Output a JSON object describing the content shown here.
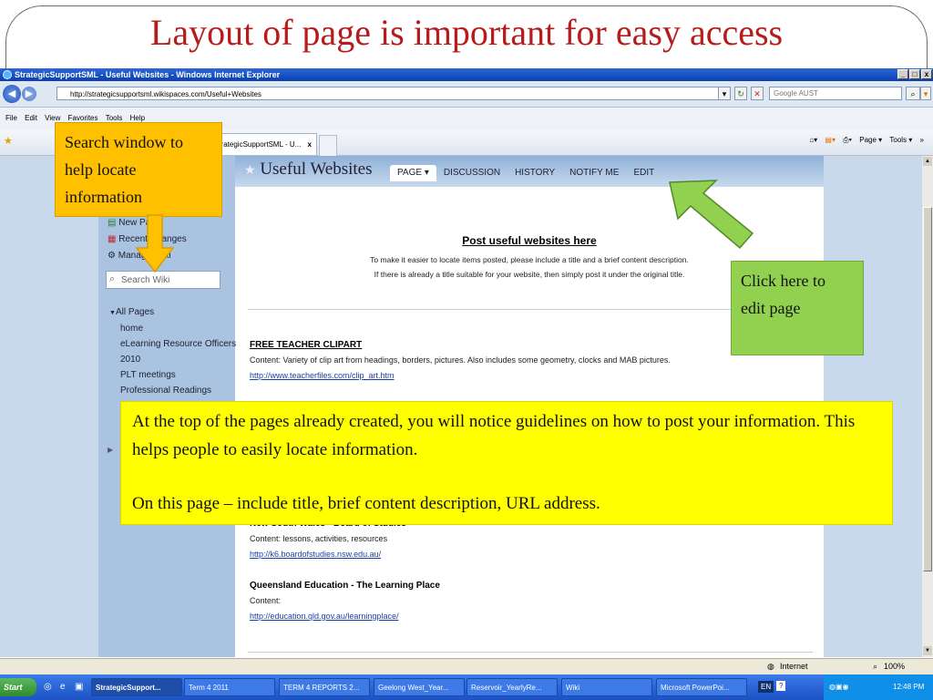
{
  "slide": {
    "title": "Layout of page is important for easy access"
  },
  "browser": {
    "title": "StrategicSupportSML - Useful Websites - Windows Internet Explorer",
    "url": "http://strategicsupportsml.wikispaces.com/Useful+Websites",
    "search_placeholder": "Google AUST",
    "menu": [
      "File",
      "Edit",
      "View",
      "Favorites",
      "Tools",
      "Help"
    ],
    "tab_label": "StrategicSupportSML - U...",
    "tab_close": "x",
    "cmd": [
      "Page ▾",
      "Tools ▾"
    ],
    "status_zone": "Internet",
    "zoom": "100%"
  },
  "wiki": {
    "page_title": "Useful Websites",
    "tabs": [
      "PAGE ▾",
      "DISCUSSION",
      "HISTORY",
      "NOTIFY ME",
      "EDIT"
    ],
    "sidebar": {
      "links": [
        "New Page",
        "Recent Changes",
        "Manage Wiki"
      ],
      "search_placeholder": "Search Wiki",
      "all_pages_label": "All Pages",
      "pages": [
        "home",
        "eLearning Resource Officers",
        "2010",
        "PLT meetings",
        "Professional Readings"
      ]
    },
    "intro": {
      "heading": "Post useful websites here",
      "line1": "To make it easier to locate items posted, please include a title and a brief content description.",
      "line2": "If there is already a title suitable for your website, then simply post it under the original title."
    },
    "entries": [
      {
        "title": "FREE TEACHER CLIPART",
        "content": "Content: Variety of clip art from headings, borders, pictures. Also includes some geometry, clocks and MAB pictures.",
        "link": "http://www.teacherfiles.com/clip_art.htm"
      },
      {
        "title": "New South Wales - Board of Studies",
        "content": "Content: lessons, activities, resources",
        "link": "http://k6.boardofstudies.nsw.edu.au/"
      },
      {
        "title": "Queensland Education - The Learning Place",
        "content": "Content:",
        "link": "http://education.qld.gov.au/learningplace/"
      }
    ]
  },
  "callouts": {
    "search": "Search window to help locate information",
    "edit": "Click here to edit page",
    "guidelines_1": "At the top of the pages already created, you will notice guidelines on how to post your information.  This helps people to easily locate information.",
    "guidelines_2": "On this page – include title, brief content description, URL address."
  },
  "taskbar": {
    "start": "Start",
    "tasks": [
      "StrategicSupport...",
      "Term 4 2011",
      "TERM 4 REPORTS 2...",
      "Geelong West_Year...",
      "Reservoir_YearlyRe...",
      "Wiki",
      "Microsoft PowerPoi..."
    ],
    "lang": "EN",
    "clock": "12:48 PM"
  },
  "colors": {
    "title_red": "#b71c1c",
    "orange": "#ffc000",
    "green": "#92d050",
    "yellow": "#ffff00"
  }
}
